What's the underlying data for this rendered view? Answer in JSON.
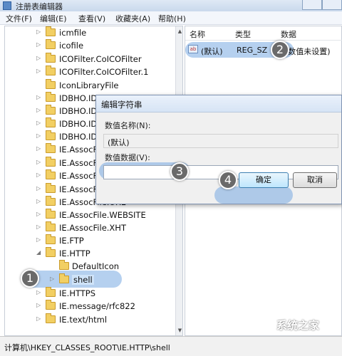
{
  "window": {
    "title": "注册表编辑器"
  },
  "menu": {
    "items": [
      "文件(F)",
      "编辑(E)",
      "查看(V)",
      "收藏夹(A)",
      "帮助(H)"
    ]
  },
  "tree": {
    "items": [
      {
        "label": "icmfile"
      },
      {
        "label": "icofile"
      },
      {
        "label": "ICOFilter.CoICOFilter"
      },
      {
        "label": "ICOFilter.CoICOFilter.1"
      },
      {
        "label": "IconLibraryFile"
      },
      {
        "label": "IDBHO.ID"
      },
      {
        "label": "IDBHO.ID"
      },
      {
        "label": "IDBHO.ID"
      },
      {
        "label": "IDBHO.ID"
      },
      {
        "label": "IE.AssocFi"
      },
      {
        "label": "IE.AssocFi"
      },
      {
        "label": "IE.AssocFi"
      },
      {
        "label": "IE.AssocFi"
      },
      {
        "label": "IE.AssocFile.URL"
      },
      {
        "label": "IE.AssocFile.WEBSITE"
      },
      {
        "label": "IE.AssocFile.XHT"
      },
      {
        "label": "IE.FTP"
      },
      {
        "label": "IE.HTTP"
      },
      {
        "label": "DefaultIcon"
      },
      {
        "label": "shell"
      },
      {
        "label": "IE.HTTPS"
      },
      {
        "label": "IE.message/rfc822"
      },
      {
        "label": "IE.text/html"
      }
    ]
  },
  "list": {
    "columns": {
      "name": "名称",
      "type": "类型",
      "data": "数据"
    },
    "rows": [
      {
        "name": "(默认)",
        "type": "REG_SZ",
        "data": "(数值未设置)"
      }
    ]
  },
  "dialog": {
    "title": "编辑字符串",
    "name_label": "数值名称(N):",
    "name_value": "(默认)",
    "data_label": "数值数据(V):",
    "data_value": "",
    "ok_label": "确定",
    "cancel_label": "取消"
  },
  "status": {
    "path": "计算机\\HKEY_CLASSES_ROOT\\IE.HTTP\\shell"
  },
  "steps": [
    "1",
    "2",
    "3",
    "4"
  ],
  "watermark": "系统之家",
  "colors": {
    "highlight": "#78aae1",
    "step_marker": "#6a6a6a",
    "folder": "#f2cf63"
  }
}
